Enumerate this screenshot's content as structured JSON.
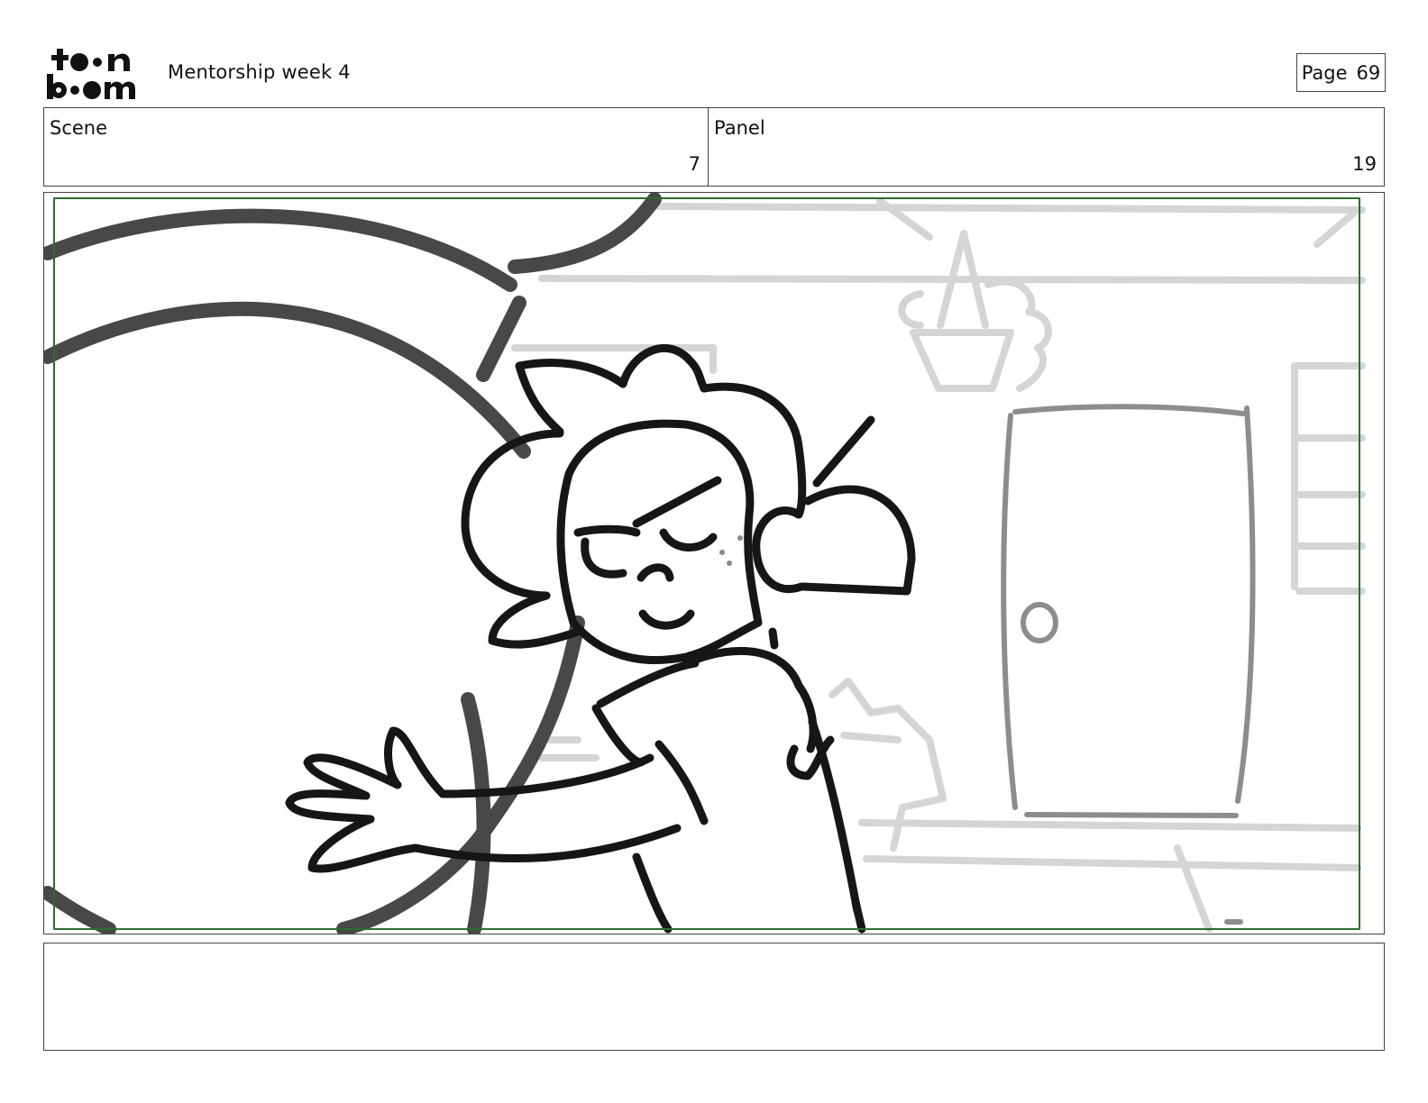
{
  "header": {
    "logo_text": "toon boom",
    "title": "Mentorship week 4",
    "page_label": "Page",
    "page_number": "69"
  },
  "info": {
    "scene_label": "Scene",
    "scene_value": "7",
    "panel_label": "Panel",
    "panel_value": "19"
  },
  "notes": {
    "text": ""
  },
  "colors": {
    "safe_frame": "#2e6b2e",
    "ink": "#111111",
    "background_sketch": "#d3d3d3",
    "door": "#8a8a8a",
    "arch": "#4a4a4a"
  }
}
